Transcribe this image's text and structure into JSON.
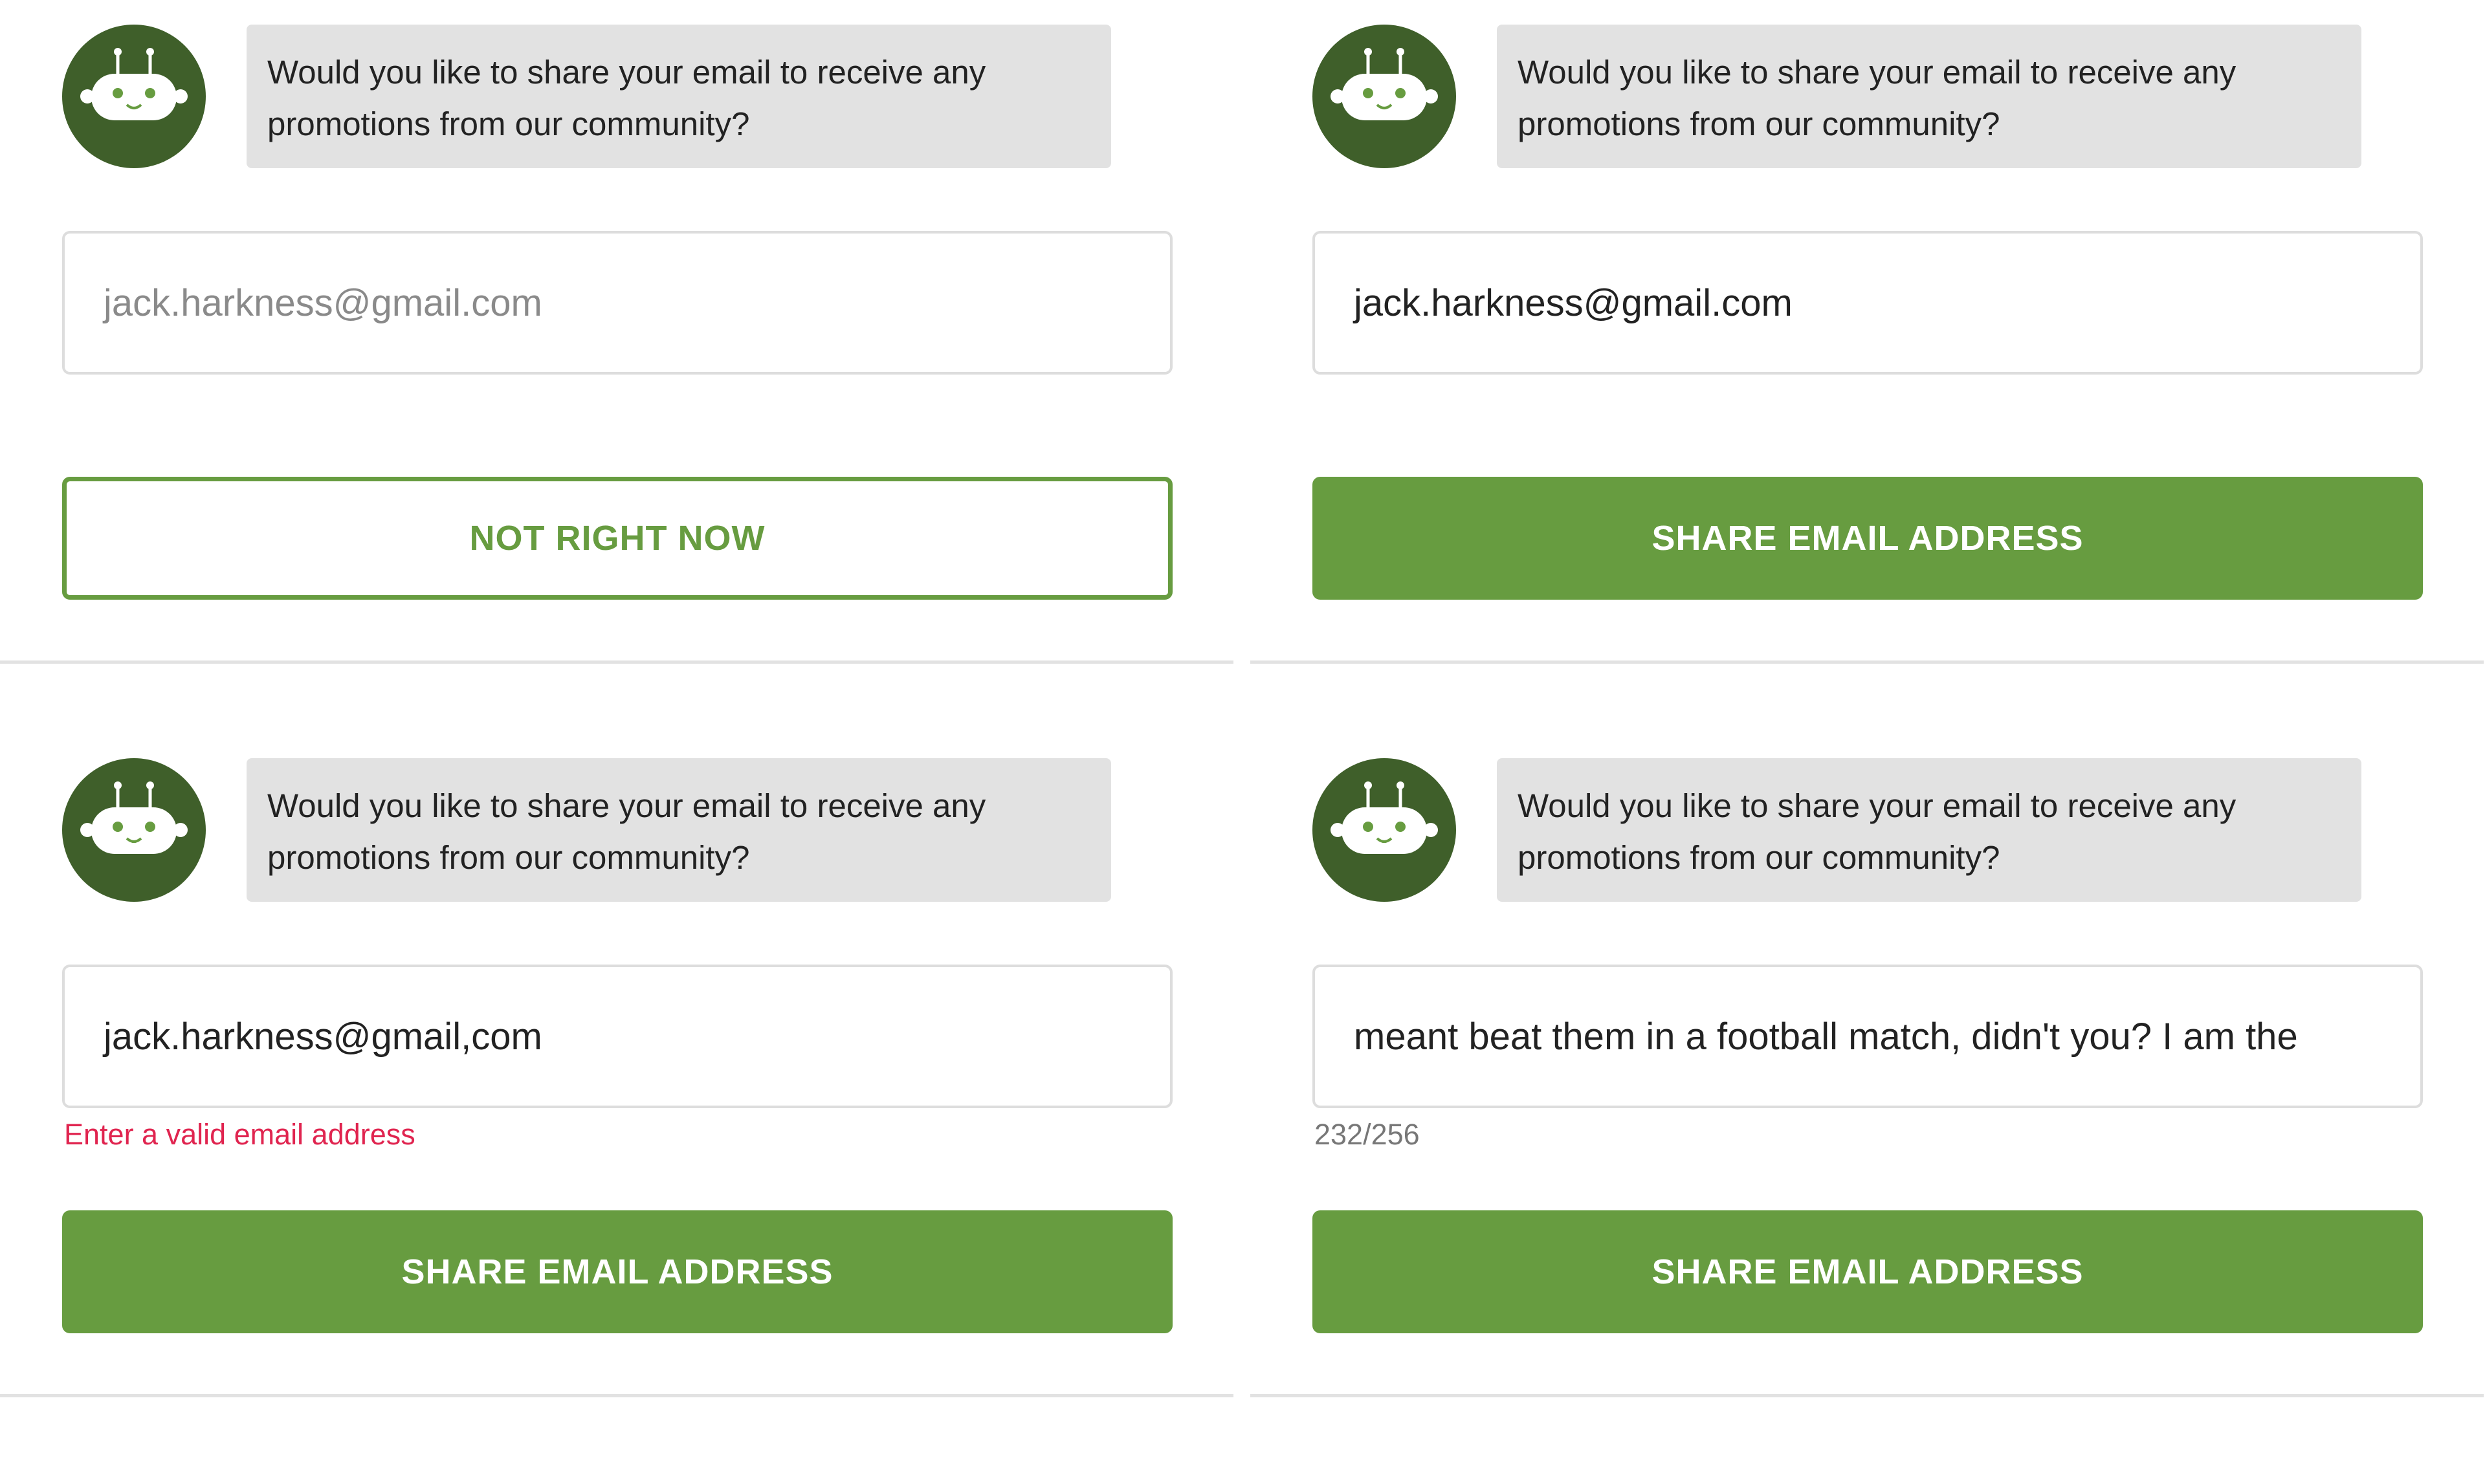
{
  "colors": {
    "brand_green": "#679c40",
    "avatar_dark_green": "#3f5f2a",
    "bubble_gray": "#e2e2e2",
    "error_red": "#e0244f",
    "helper_gray": "#777777"
  },
  "icons": {
    "avatar": "robot-icon"
  },
  "panels": [
    {
      "message": "Would you like to share your email to receive any promotions from our community?",
      "email_placeholder": "jack.harkness@gmail.com",
      "email_value": "",
      "button_label": "NOT RIGHT NOW",
      "button_style": "outline"
    },
    {
      "message": "Would you like to share your email to receive any promotions from our community?",
      "email_value": "jack.harkness@gmail.com",
      "button_label": "SHARE EMAIL ADDRESS",
      "button_style": "filled"
    },
    {
      "message": "Would you like to share your email to receive any promotions from our community?",
      "email_value": "jack.harkness@gmail,com",
      "error_text": "Enter a valid email address",
      "button_label": "SHARE EMAIL ADDRESS",
      "button_style": "filled"
    },
    {
      "message": "Would you like to share your email to receive any promotions from our community?",
      "email_value": "meant beat them in a football match, didn't you? I am the",
      "char_counter": "232/256",
      "button_label": "SHARE EMAIL ADDRESS",
      "button_style": "filled"
    }
  ]
}
